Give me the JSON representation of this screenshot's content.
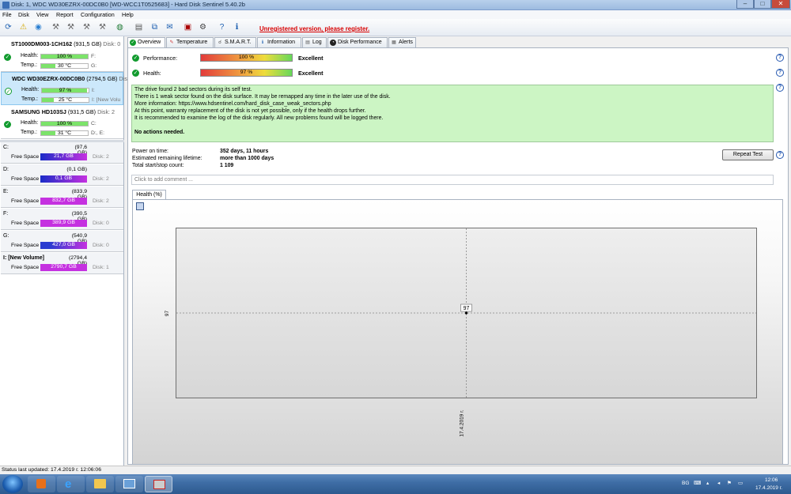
{
  "window": {
    "title": "Disk: 1, WDC WD30EZRX-00DC0B0 [WD-WCC1T0525683]  -  Hard Disk Sentinel 5.40.2b",
    "controls": {
      "minimize": "–",
      "maximize": "□",
      "close": "✕"
    }
  },
  "menu": [
    "File",
    "Disk",
    "View",
    "Report",
    "Configuration",
    "Help"
  ],
  "toolbar": {
    "icons": [
      "refresh-icon",
      "alert-icon",
      "report-icon",
      "disk-tool-icon",
      "disk-tool2-icon",
      "disk-tool3-icon",
      "globe-icon",
      "document-icon",
      "copy-icon",
      "send-icon",
      "chip-icon",
      "settings-icon",
      "help-icon",
      "info-icon"
    ],
    "unregistered_label": "Unregistered version, please register."
  },
  "disks": [
    {
      "name": "ST1000DM003-1CH162",
      "size": "(931,5 GB)",
      "disk": "Disk: 0",
      "health": "100 %",
      "health_pct": 100,
      "temp": "30 °C",
      "temp_pct": 30,
      "drives_h": "F:",
      "drives_t": "G:"
    },
    {
      "name": "WDC WD30EZRX-00DC0B0",
      "size": "(2794,5 GB)",
      "disk": "Disk: 1",
      "health": "97 %",
      "health_pct": 97,
      "temp": "25 °C",
      "temp_pct": 25,
      "drives_h": "I:",
      "drives_t": "I: [New Volu"
    },
    {
      "name": "SAMSUNG HD103SJ",
      "size": "(931,5 GB)",
      "disk": "Disk: 2",
      "health": "100 %",
      "health_pct": 100,
      "temp": "31 °C",
      "temp_pct": 31,
      "drives_h": "C:",
      "drives_t": "D:, E:"
    }
  ],
  "health_label": "Health:",
  "temp_label": "Temp.:",
  "free_space_label": "Free Space",
  "volumes": [
    {
      "name": "C:",
      "size": "(97,6 GB)",
      "free": "21,7 GB",
      "disk": "Disk: 2"
    },
    {
      "name": "D:",
      "size": "(0,1 GB)",
      "free": "0,1 GB",
      "disk": "Disk: 2"
    },
    {
      "name": "E:",
      "size": "(833,9 GB)",
      "free": "832,7 GB",
      "disk": "Disk: 2"
    },
    {
      "name": "F:",
      "size": "(390,5 GB)",
      "free": "389,9 GB",
      "disk": "Disk: 0"
    },
    {
      "name": "G:",
      "size": "(540,9 GB)",
      "free": "427,0 GB",
      "disk": "Disk: 0"
    },
    {
      "name": "I: [New Volume]",
      "size": "(2794,4 GB)",
      "free": "2790,7 GB",
      "disk": "Disk: 1"
    }
  ],
  "tabs": [
    "Overview",
    "Temperature",
    "S.M.A.R.T.",
    "Information",
    "Log",
    "Disk Performance",
    "Alerts"
  ],
  "overview": {
    "performance_label": "Performance:",
    "performance_value": "100 %",
    "performance_pct": 100,
    "performance_text": "Excellent",
    "health_label": "Health:",
    "health_value": "97 %",
    "health_pct": 97,
    "health_text": "Excellent",
    "message": [
      "The drive found 2 bad sectors during its self test.",
      "There is 1 weak sector found on the disk surface. It may be remapped any time in the later use of the disk.",
      "More information: https://www.hdsentinel.com/hard_disk_case_weak_sectors.php",
      "At this point, warranty replacement of the disk is not yet possible, only if the health drops further.",
      "It is recommended to examine the log of the disk regularly. All new problems found will be logged there.",
      "",
      "No actions needed."
    ],
    "power_on_label": "Power on time:",
    "power_on_value": "352 days, 11 hours",
    "lifetime_label": "Estimated remaining lifetime:",
    "lifetime_value": "more than 1000 days",
    "startstop_label": "Total start/stop count:",
    "startstop_value": "1 109",
    "repeat_test": "Repeat Test",
    "comment_placeholder": "Click to add comment ...",
    "health_tab": "Health (%)",
    "help": "?"
  },
  "chart_data": {
    "type": "scatter",
    "title": "Health (%)",
    "x": [
      "17.4.2019 г."
    ],
    "values": [
      97
    ],
    "y_tick": "97",
    "x_tick": "17.4.2019 г.",
    "data_label": "97"
  },
  "statusbar": "Status last updated: 17.4.2019 г. 12:06:06",
  "taskbar": {
    "lang": "BG",
    "time": "12:06",
    "date": "17.4.2019 г."
  }
}
